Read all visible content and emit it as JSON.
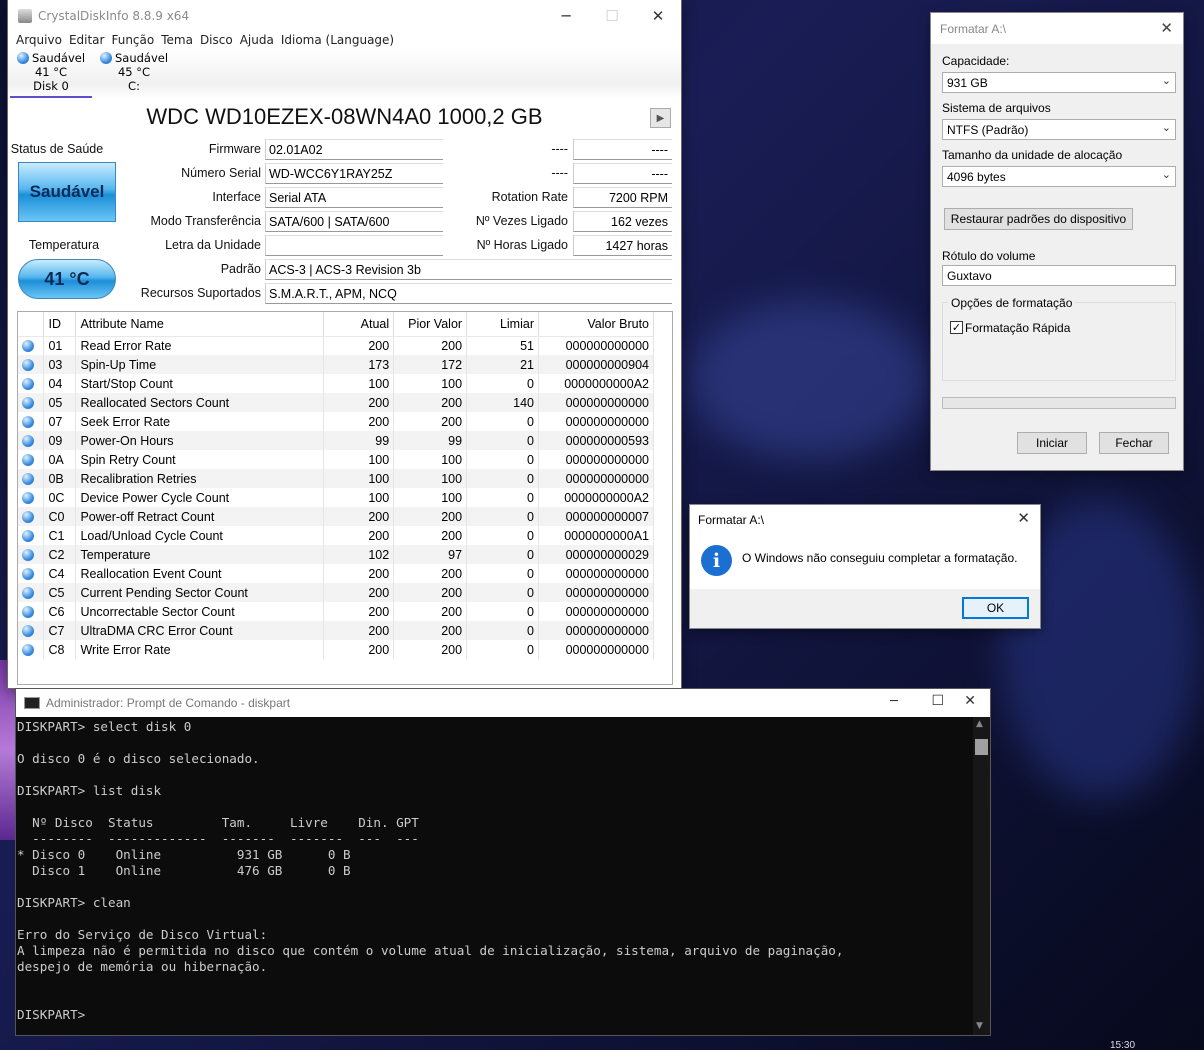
{
  "crystal": {
    "title": "CrystalDiskInfo 8.8.9 x64",
    "menu": [
      "Arquivo",
      "Editar",
      "Função",
      "Tema",
      "Disco",
      "Ajuda",
      "Idioma (Language)"
    ],
    "disks": [
      {
        "status": "Saudável",
        "temp": "41 °C",
        "name": "Disk 0"
      },
      {
        "status": "Saudável",
        "temp": "45 °C",
        "name": "C:"
      }
    ],
    "model": "WDC WD10EZEX-08WN4A0 1000,2 GB",
    "health_label": "Status de Saúde",
    "health": "Saudável",
    "temp_label": "Temperatura",
    "temp": "41 °C",
    "fields": {
      "firmware_label": "Firmware",
      "firmware": "02.01A02",
      "serial_label": "Número Serial",
      "serial": "WD-WCC6Y1RAY25Z",
      "interface_label": "Interface",
      "interface": "Serial ATA",
      "transfer_label": "Modo Transferência",
      "transfer": "SATA/600 | SATA/600",
      "drive_label": "Letra da Unidade",
      "drive": "",
      "standard_label": "Padrão",
      "standard": "ACS-3 | ACS-3 Revision 3b",
      "features_label": "Recursos Suportados",
      "features": "S.M.A.R.T., APM, NCQ",
      "dash1": "----",
      "dash2": "----",
      "dash3": "----",
      "dash4": "----",
      "rotation_label": "Rotation Rate",
      "rotation": "7200 RPM",
      "powercount_label": "Nº Vezes Ligado",
      "powercount": "162 vezes",
      "powerhours_label": "Nº Horas Ligado",
      "powerhours": "1427 horas"
    },
    "smart_headers": [
      "ID",
      "Attribute Name",
      "Atual",
      "Pior Valor",
      "Limiar",
      "Valor Bruto"
    ],
    "smart_rows": [
      [
        "01",
        "Read Error Rate",
        "200",
        "200",
        "51",
        "000000000000"
      ],
      [
        "03",
        "Spin-Up Time",
        "173",
        "172",
        "21",
        "000000000904"
      ],
      [
        "04",
        "Start/Stop Count",
        "100",
        "100",
        "0",
        "0000000000A2"
      ],
      [
        "05",
        "Reallocated Sectors Count",
        "200",
        "200",
        "140",
        "000000000000"
      ],
      [
        "07",
        "Seek Error Rate",
        "200",
        "200",
        "0",
        "000000000000"
      ],
      [
        "09",
        "Power-On Hours",
        "99",
        "99",
        "0",
        "000000000593"
      ],
      [
        "0A",
        "Spin Retry Count",
        "100",
        "100",
        "0",
        "000000000000"
      ],
      [
        "0B",
        "Recalibration Retries",
        "100",
        "100",
        "0",
        "000000000000"
      ],
      [
        "0C",
        "Device Power Cycle Count",
        "100",
        "100",
        "0",
        "0000000000A2"
      ],
      [
        "C0",
        "Power-off Retract Count",
        "200",
        "200",
        "0",
        "000000000007"
      ],
      [
        "C1",
        "Load/Unload Cycle Count",
        "200",
        "200",
        "0",
        "0000000000A1"
      ],
      [
        "C2",
        "Temperature",
        "102",
        "97",
        "0",
        "000000000029"
      ],
      [
        "C4",
        "Reallocation Event Count",
        "200",
        "200",
        "0",
        "000000000000"
      ],
      [
        "C5",
        "Current Pending Sector Count",
        "200",
        "200",
        "0",
        "000000000000"
      ],
      [
        "C6",
        "Uncorrectable Sector Count",
        "200",
        "200",
        "0",
        "000000000000"
      ],
      [
        "C7",
        "UltraDMA CRC Error Count",
        "200",
        "200",
        "0",
        "000000000000"
      ],
      [
        "C8",
        "Write Error Rate",
        "200",
        "200",
        "0",
        "000000000000"
      ]
    ]
  },
  "format": {
    "title": "Formatar A:\\",
    "capacity_label": "Capacidade:",
    "capacity": "931 GB",
    "fs_label": "Sistema de arquivos",
    "fs": "NTFS (Padrão)",
    "alloc_label": "Tamanho da unidade de alocação",
    "alloc": "4096 bytes",
    "restore": "Restaurar padrões do dispositivo",
    "volume_label": "Rótulo do volume",
    "volume": "Guxtavo",
    "options_label": "Opções de formatação",
    "quick": "Formatação Rápida",
    "start": "Iniciar",
    "close": "Fechar"
  },
  "error": {
    "title": "Formatar A:\\",
    "message": "O Windows não conseguiu completar a formatação.",
    "ok": "OK"
  },
  "cmd": {
    "title": "Administrador: Prompt de Comando - diskpart",
    "text": "DISKPART> select disk 0\n\nO disco 0 é o disco selecionado.\n\nDISKPART> list disk\n\n  Nº Disco  Status         Tam.     Livre    Din. GPT\n  --------  -------------  -------  -------  ---  ---\n* Disco 0    Online          931 GB      0 B\n  Disco 1    Online          476 GB      0 B\n\nDISKPART> clean\n\nErro do Serviço de Disco Virtual:\nA limpeza não é permitida no disco que contém o volume atual de inicialização, sistema, arquivo de paginação,\ndespejo de memória ou hibernação.\n\n\nDISKPART> "
  },
  "clock": "15:30"
}
